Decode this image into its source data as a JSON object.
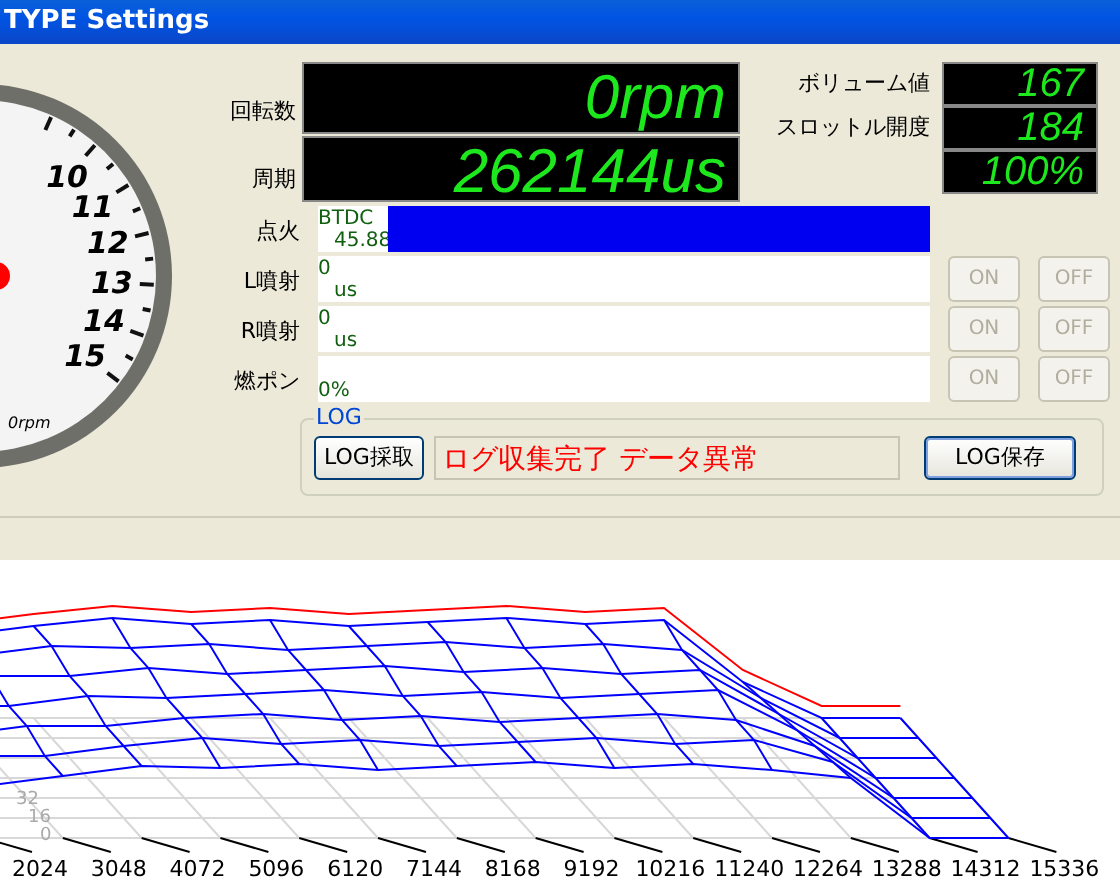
{
  "window": {
    "title": "TYPE Settings"
  },
  "gauge": {
    "scale_labels": [
      "10",
      "11",
      "12",
      "13",
      "14",
      "15"
    ],
    "unit": "0rpm"
  },
  "readouts": [
    {
      "label": "回転数",
      "value": "0rpm"
    },
    {
      "label": "周期",
      "value": "262144us"
    }
  ],
  "sensors": [
    {
      "label": "ボリューム値",
      "value": "167"
    },
    {
      "label": "スロットル開度",
      "value": "184"
    },
    {
      "value": "100%"
    }
  ],
  "outputs": [
    {
      "kind": "bar",
      "label": "点火",
      "lines": [
        "BTDC",
        "45.88"
      ],
      "level": 1
    },
    {
      "kind": "text",
      "label": "L噴射",
      "lines": [
        "0",
        "us"
      ],
      "buttons": [
        {
          "label": "ON",
          "disabled": true
        },
        {
          "label": "OFF",
          "disabled": true
        }
      ]
    },
    {
      "kind": "text",
      "label": "R噴射",
      "lines": [
        "0",
        "us"
      ],
      "buttons": [
        {
          "label": "ON",
          "disabled": true
        },
        {
          "label": "OFF",
          "disabled": true
        }
      ]
    },
    {
      "kind": "text",
      "label": "燃ポン",
      "lines": [
        "0%"
      ],
      "buttons": [
        {
          "label": "ON",
          "disabled": true
        },
        {
          "label": "OFF",
          "disabled": true
        }
      ]
    }
  ],
  "log": {
    "title": "LOG",
    "capture_button": "LOG採取",
    "status": "ログ収集完了 データ異常",
    "save_button": "LOG保存"
  },
  "map_chart": {
    "x_labels": [
      "2024",
      "3048",
      "4072",
      "5096",
      "6120",
      "7144",
      "8168",
      "9192",
      "10216",
      "11240",
      "12264",
      "13288",
      "14312",
      "15336"
    ],
    "y_labels": [
      "32",
      "16",
      "0"
    ]
  }
}
